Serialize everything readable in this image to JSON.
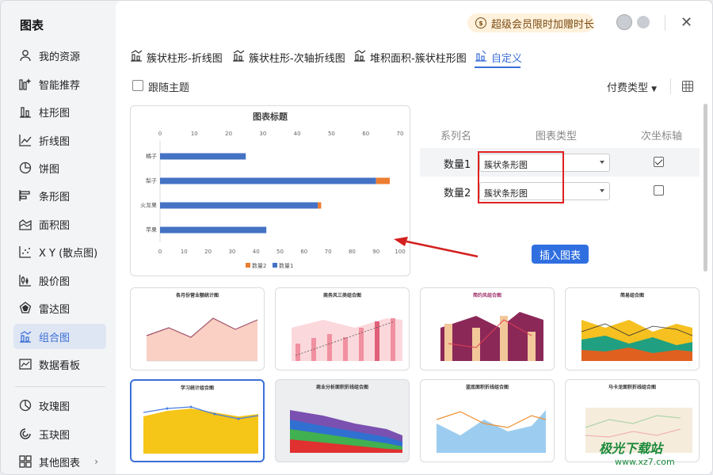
{
  "sidebar": {
    "title": "图表",
    "items": [
      {
        "label": "我的资源"
      },
      {
        "label": "智能推荐"
      },
      {
        "label": "柱形图"
      },
      {
        "label": "折线图"
      },
      {
        "label": "饼图"
      },
      {
        "label": "条形图"
      },
      {
        "label": "面积图"
      },
      {
        "label": "X Y (散点图)"
      },
      {
        "label": "股价图"
      },
      {
        "label": "雷达图"
      },
      {
        "label": "组合图"
      },
      {
        "label": "数据看板"
      },
      {
        "label": "玫瑰图"
      },
      {
        "label": "玉玦图"
      },
      {
        "label": "其他图表"
      }
    ]
  },
  "header": {
    "promo": "超级会员限时加赠时长",
    "coin_glyph": "$"
  },
  "tabs": [
    {
      "label": "簇状柱形-折线图"
    },
    {
      "label": "簇状柱形-次轴折线图"
    },
    {
      "label": "堆积面积-簇状柱形图"
    },
    {
      "label": "自定义"
    }
  ],
  "toolbar": {
    "follow_theme": "跟随主题",
    "paid_type": "付费类型"
  },
  "preview": {
    "chart_data": {
      "type": "bar",
      "title": "图表标题",
      "categories": [
        "橘子",
        "梨子",
        "火龙果",
        "苹果"
      ],
      "series": [
        {
          "name": "数量2",
          "values": [
            0,
            4,
            1,
            0
          ],
          "color": "#ed7d31"
        },
        {
          "name": "数量1",
          "values": [
            25,
            63,
            46,
            31
          ],
          "color": "#4472c4"
        }
      ],
      "top_axis_ticks": [
        "0",
        "10",
        "20",
        "30",
        "40",
        "50",
        "60",
        "70"
      ],
      "bottom_axis_ticks": [
        "0",
        "10",
        "20",
        "30",
        "40",
        "50",
        "60",
        "70",
        "80",
        "90",
        "100"
      ],
      "legend": "bottom"
    }
  },
  "series_table": {
    "headers": [
      "系列名",
      "图表类型",
      "次坐标轴"
    ],
    "rows": [
      {
        "name": "数量1",
        "type": "簇状条形图",
        "secondary": true
      },
      {
        "name": "数量2",
        "type": "簇状条形图",
        "secondary": false
      }
    ]
  },
  "insert_button": "插入图表",
  "templates": [
    {
      "title": "各月份营业额统计图"
    },
    {
      "title": "商务风三类组合图"
    },
    {
      "title": "简约风组合图"
    },
    {
      "title": "简易组合图"
    },
    {
      "title": "学习统计组合图"
    },
    {
      "title": "商业分析面积折线组合图"
    },
    {
      "title": "蓝底面积折线组合图"
    },
    {
      "title": "马卡龙面积折线组合图"
    }
  ],
  "watermark": {
    "line1": "极光下载站",
    "line2": "www.xz7.com"
  }
}
